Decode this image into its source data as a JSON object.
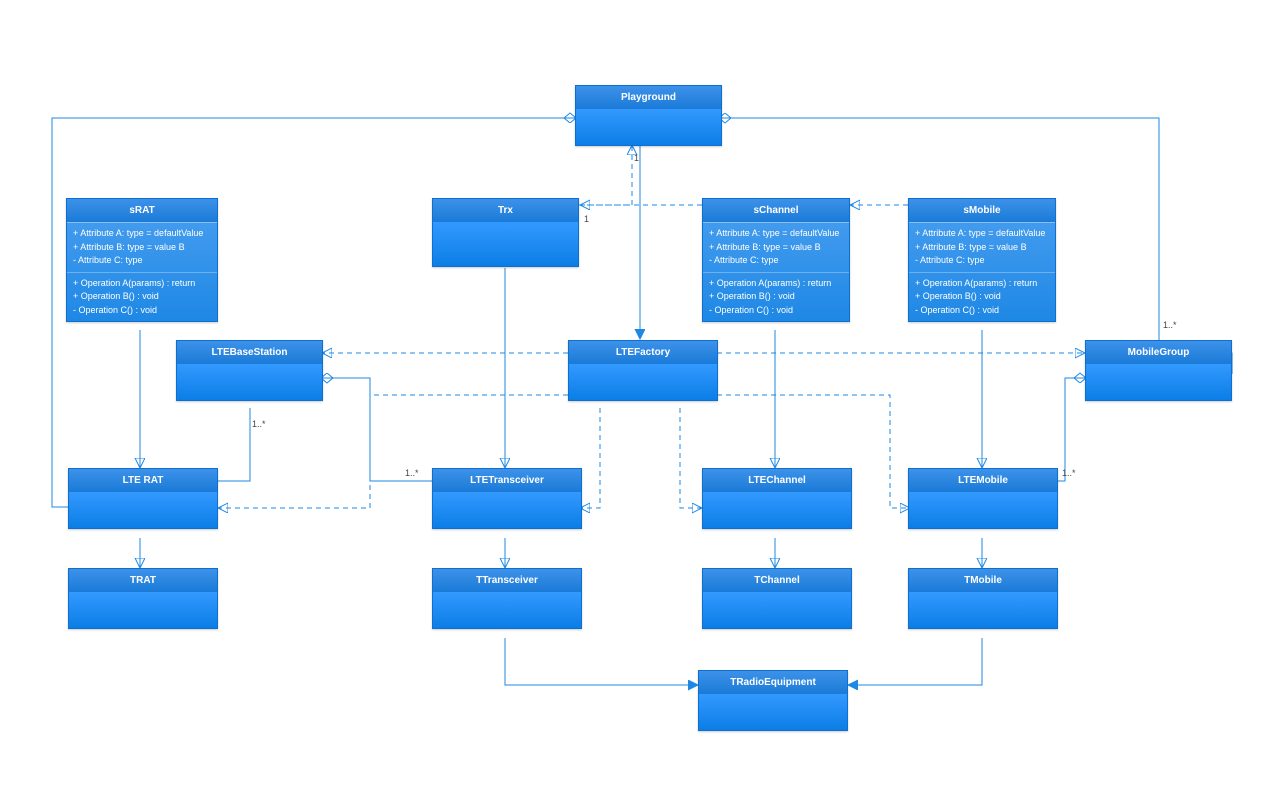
{
  "playground": {
    "title": "Playground"
  },
  "sRAT": {
    "title": "sRAT",
    "attrs": [
      "+  Attribute A: type = defaultValue",
      "+  Attribute B: type = value B",
      "-   Attribute C: type"
    ],
    "ops": [
      "+  Operation A(params) : return",
      "+  Operation B() : void",
      "-   Operation C() : void"
    ]
  },
  "trx": {
    "title": "Trx"
  },
  "sChannel": {
    "title": "sChannel",
    "attrs": [
      "+  Attribute A: type = defaultValue",
      "+  Attribute B: type = value B",
      "-   Attribute C: type"
    ],
    "ops": [
      "+  Operation A(params) : return",
      "+  Operation B() : void",
      "-   Operation C() : void"
    ]
  },
  "sMobile": {
    "title": "sMobile",
    "attrs": [
      "+  Attribute A: type = defaultValue",
      "+  Attribute B: type = value B",
      "-   Attribute C: type"
    ],
    "ops": [
      "+  Operation A(params) : return",
      "+  Operation B() : void",
      "-   Operation C() : void"
    ]
  },
  "lteBaseStation": {
    "title": "LTEBaseStation"
  },
  "lteFactory": {
    "title": "LTEFactory"
  },
  "mobileGroup": {
    "title": "MobileGroup"
  },
  "lteRat": {
    "title": "LTE RAT"
  },
  "lteTransceiver": {
    "title": "LTETransceiver"
  },
  "lteChannel": {
    "title": "LTEChannel"
  },
  "lteMobile": {
    "title": "LTEMobile"
  },
  "trat": {
    "title": "TRAT"
  },
  "tTransceiver": {
    "title": "TTransceiver"
  },
  "tChannel": {
    "title": "TChannel"
  },
  "tMobile": {
    "title": "TMobile"
  },
  "tRadioEquipment": {
    "title": "TRadioEquipment"
  },
  "mult": {
    "one": "1",
    "oneStar": "1..*"
  }
}
